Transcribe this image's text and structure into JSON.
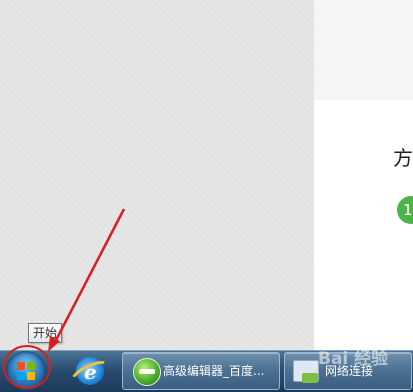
{
  "page": {
    "heading_char": "方",
    "step_number": "1"
  },
  "tooltip": {
    "text": "开始"
  },
  "taskbar": {
    "start_button": {
      "icon": "windows-logo-icon"
    },
    "pinned": [
      {
        "icon": "internet-explorer-icon"
      }
    ],
    "items": [
      {
        "icon": "browser-globe-icon",
        "label": "高级编辑器_百度..."
      },
      {
        "icon": "network-icon",
        "label": "网络连接"
      }
    ]
  },
  "watermark": {
    "text": "Bai 经验"
  },
  "annotation": {
    "color": "#d81e1e"
  }
}
